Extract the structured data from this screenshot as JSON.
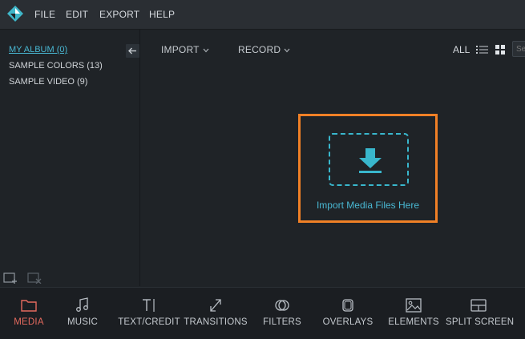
{
  "menubar": {
    "items": [
      "FILE",
      "EDIT",
      "EXPORT",
      "HELP"
    ]
  },
  "sidebar": {
    "albums": [
      {
        "label": "MY ALBUM (0)",
        "active": true
      },
      {
        "label": "SAMPLE COLORS (13)",
        "active": false
      },
      {
        "label": "SAMPLE VIDEO (9)",
        "active": false
      }
    ]
  },
  "toolbar": {
    "import_label": "IMPORT",
    "record_label": "RECORD",
    "view_all_label": "ALL",
    "search_placeholder": "Search"
  },
  "import_zone": {
    "label": "Import Media Files Here"
  },
  "bottom_tabs": [
    {
      "label": "MEDIA",
      "icon": "folder-icon",
      "active": true
    },
    {
      "label": "MUSIC",
      "icon": "music-note-icon",
      "active": false
    },
    {
      "label": "TEXT/CREDIT",
      "icon": "text-icon",
      "active": false
    },
    {
      "label": "TRANSITIONS",
      "icon": "transitions-icon",
      "active": false
    },
    {
      "label": "FILTERS",
      "icon": "filters-icon",
      "active": false
    },
    {
      "label": "OVERLAYS",
      "icon": "overlays-icon",
      "active": false
    },
    {
      "label": "ELEMENTS",
      "icon": "image-icon",
      "active": false
    },
    {
      "label": "SPLIT SCREEN",
      "icon": "split-screen-icon",
      "active": false
    }
  ],
  "colors": {
    "accent": "#49b8d3",
    "highlight_border": "#f08026",
    "active_tab": "#e46a5e",
    "background": "#1f2327"
  }
}
